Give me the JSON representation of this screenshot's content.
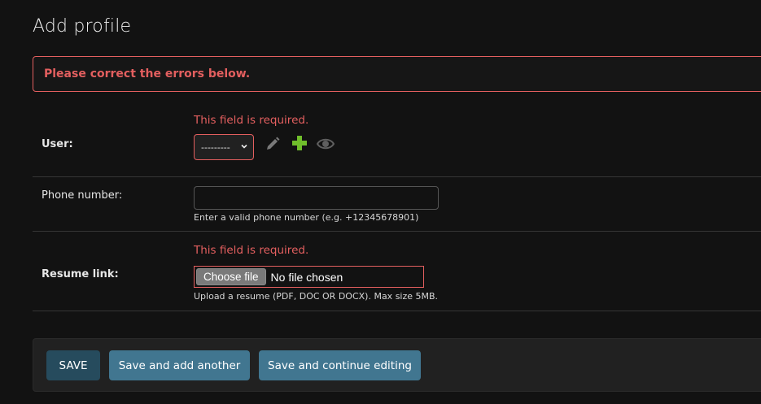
{
  "page": {
    "title": "Add profile",
    "error_note": "Please correct the errors below."
  },
  "fields": {
    "user": {
      "label": "User:",
      "error": "This field is required.",
      "selected": "---------",
      "icons": [
        "pencil-icon",
        "plus-icon",
        "eye-icon"
      ]
    },
    "phone": {
      "label": "Phone number:",
      "value": "",
      "help": "Enter a valid phone number (e.g. +12345678901)"
    },
    "resume": {
      "label": "Resume link:",
      "error": "This field is required.",
      "button": "Choose file",
      "status": "No file chosen",
      "help": "Upload a resume (PDF, DOC OR DOCX). Max size 5MB."
    }
  },
  "actions": {
    "save": "SAVE",
    "save_add_another": "Save and add another",
    "save_continue": "Save and continue editing"
  },
  "colors": {
    "error": "#e35f5f",
    "button_primary": "#417690",
    "button_default": "#264b5d",
    "add_icon": "#70bf2b",
    "background": "#121212"
  }
}
